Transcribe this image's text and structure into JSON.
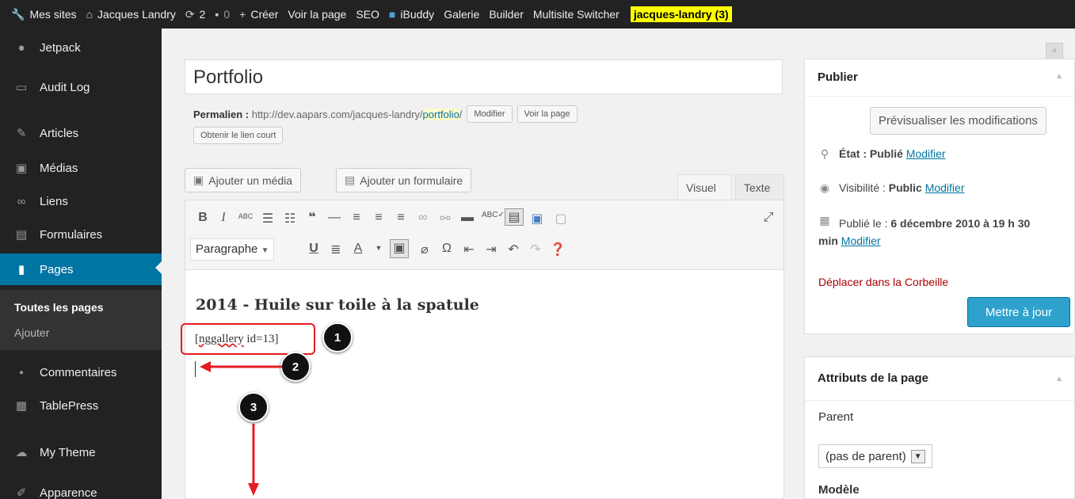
{
  "admin_bar": {
    "my_sites": "Mes sites",
    "site_name": "Jacques Landry",
    "updates_count": "2",
    "comments_count": "0",
    "new": "Créer",
    "view_page": "Voir la page",
    "seo": "SEO",
    "ibuddy": "iBuddy",
    "gallery": "Galerie",
    "builder": "Builder",
    "multisite": "Multisite Switcher",
    "user": "jacques-landry (3)"
  },
  "sidebar": {
    "jetpack": "Jetpack",
    "audit_log": "Audit Log",
    "articles": "Articles",
    "medias": "Médias",
    "liens": "Liens",
    "formulaires": "Formulaires",
    "pages": "Pages",
    "all_pages": "Toutes les pages",
    "add": "Ajouter",
    "comments": "Commentaires",
    "tablepress": "TablePress",
    "my_theme": "My Theme",
    "appearance": "Apparence"
  },
  "editor": {
    "title_value": "Portfolio",
    "permalink_label": "Permalien :",
    "permalink_base": "http://dev.aapars.com/jacques-landry/",
    "permalink_slug": "portfolio",
    "permalink_end": "/",
    "modify_button": "Modifier",
    "view_page_button": "Voir la page",
    "short_link_button": "Obtenir le lien court",
    "add_media": "Ajouter un média",
    "add_form": "Ajouter un formulaire",
    "tab_visual": "Visuel",
    "tab_text": "Texte",
    "format_value": "Paragraphe",
    "heading": "2014 - Huile sur toile à la spatule",
    "shortcode_err": "nggallery",
    "shortcode_rest": " id=13]",
    "shortcode_open": "["
  },
  "annotations": [
    "1",
    "2",
    "3"
  ],
  "publish": {
    "title": "Publier",
    "preview": "Prévisualiser les modifications",
    "status_label": "État :",
    "status_value": "Publié",
    "visibility_label": "Visibilité :",
    "visibility_value": "Public",
    "published_label": "Publié le :",
    "published_value": "6 décembre 2010 à 19 h 30",
    "published_value_2": "min",
    "modify_link": "Modifier",
    "trash": "Déplacer dans la Corbeille",
    "update": "Mettre à jour"
  },
  "attributes": {
    "title": "Attributs de la page",
    "parent_label": "Parent",
    "parent_value": "(pas de parent)",
    "model_label": "Modèle"
  },
  "colors": {
    "admin_blue": "#0074a2",
    "annotation_red": "#e51c23",
    "highlight_yellow": "#ffff00"
  }
}
